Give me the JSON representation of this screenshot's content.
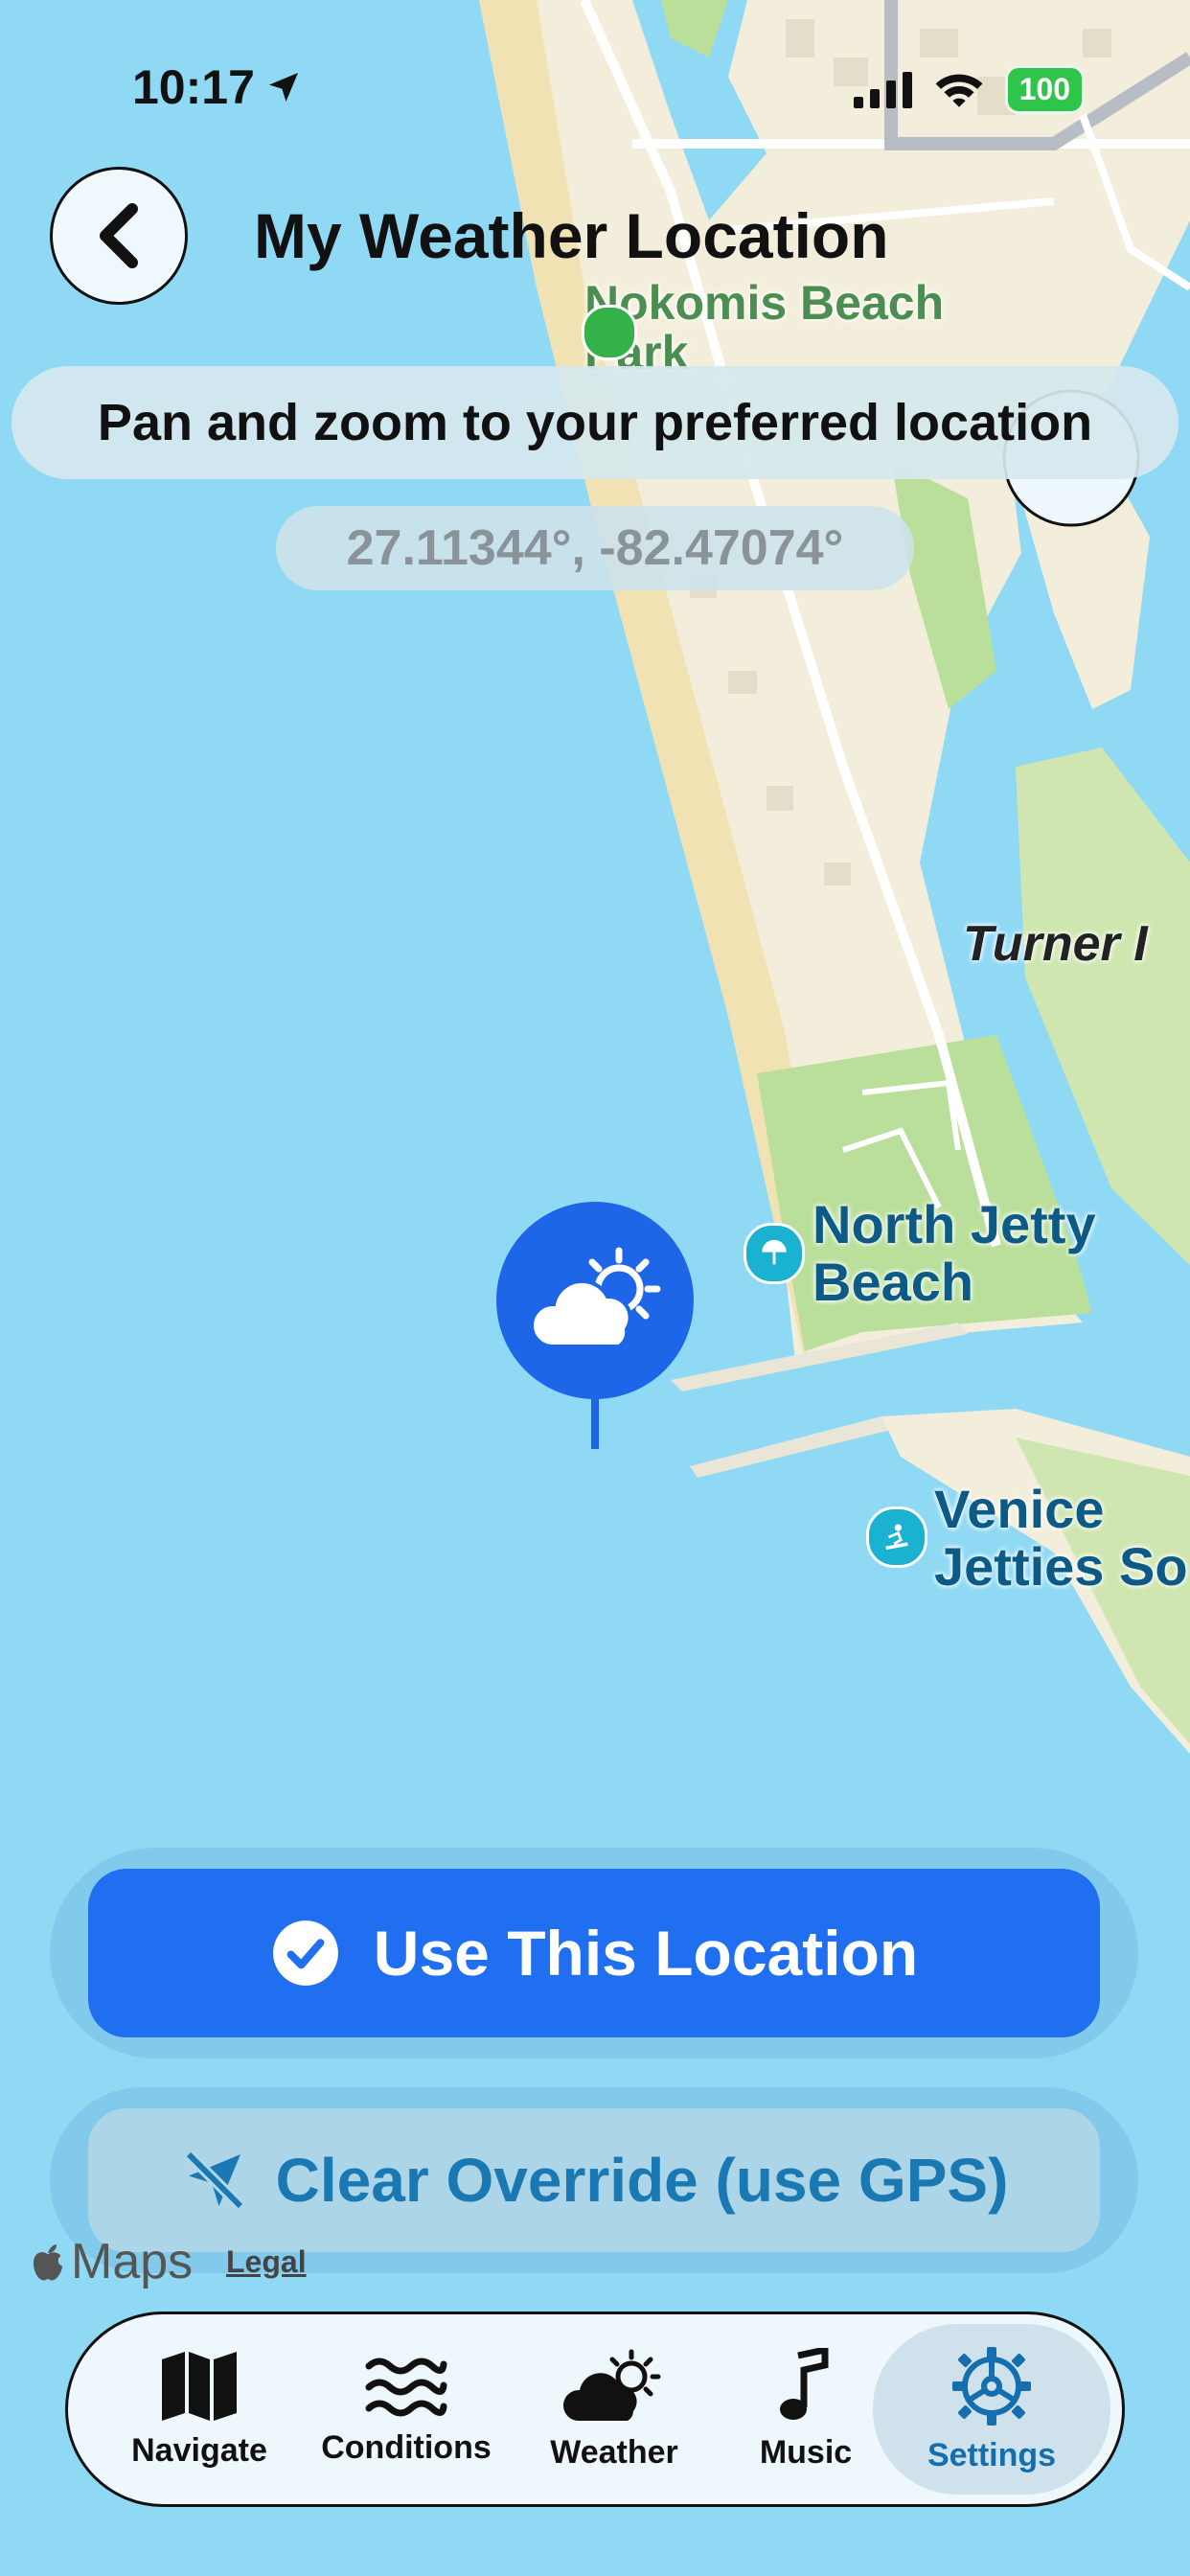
{
  "status_bar": {
    "time": "10:17",
    "battery": "100"
  },
  "header": {
    "title": "My Weather Location"
  },
  "hint": "Pan and zoom to your preferred location",
  "coords": "27.11344°, -82.47074°",
  "map_labels": {
    "park": "Nokomis Beach Park",
    "island": "Turner I",
    "beach1_line1": "North Jetty",
    "beach1_line2": "Beach",
    "beach2_line1": "Venice",
    "beach2_line2": "Jetties So"
  },
  "buttons": {
    "use_location": "Use This Location",
    "clear_override": "Clear Override (use GPS)"
  },
  "attribution": {
    "maps": "Maps",
    "legal": "Legal"
  },
  "tabs": [
    {
      "label": "Navigate",
      "icon": "map-icon"
    },
    {
      "label": "Conditions",
      "icon": "waves-icon"
    },
    {
      "label": "Weather",
      "icon": "partly-cloudy-icon"
    },
    {
      "label": "Music",
      "icon": "music-note-icon"
    },
    {
      "label": "Settings",
      "icon": "gear-icon",
      "active": true
    }
  ],
  "colors": {
    "accent": "#1f6ff0",
    "water": "#8fd9f5",
    "land": "#f3eedb",
    "park": "#b9df9a"
  }
}
